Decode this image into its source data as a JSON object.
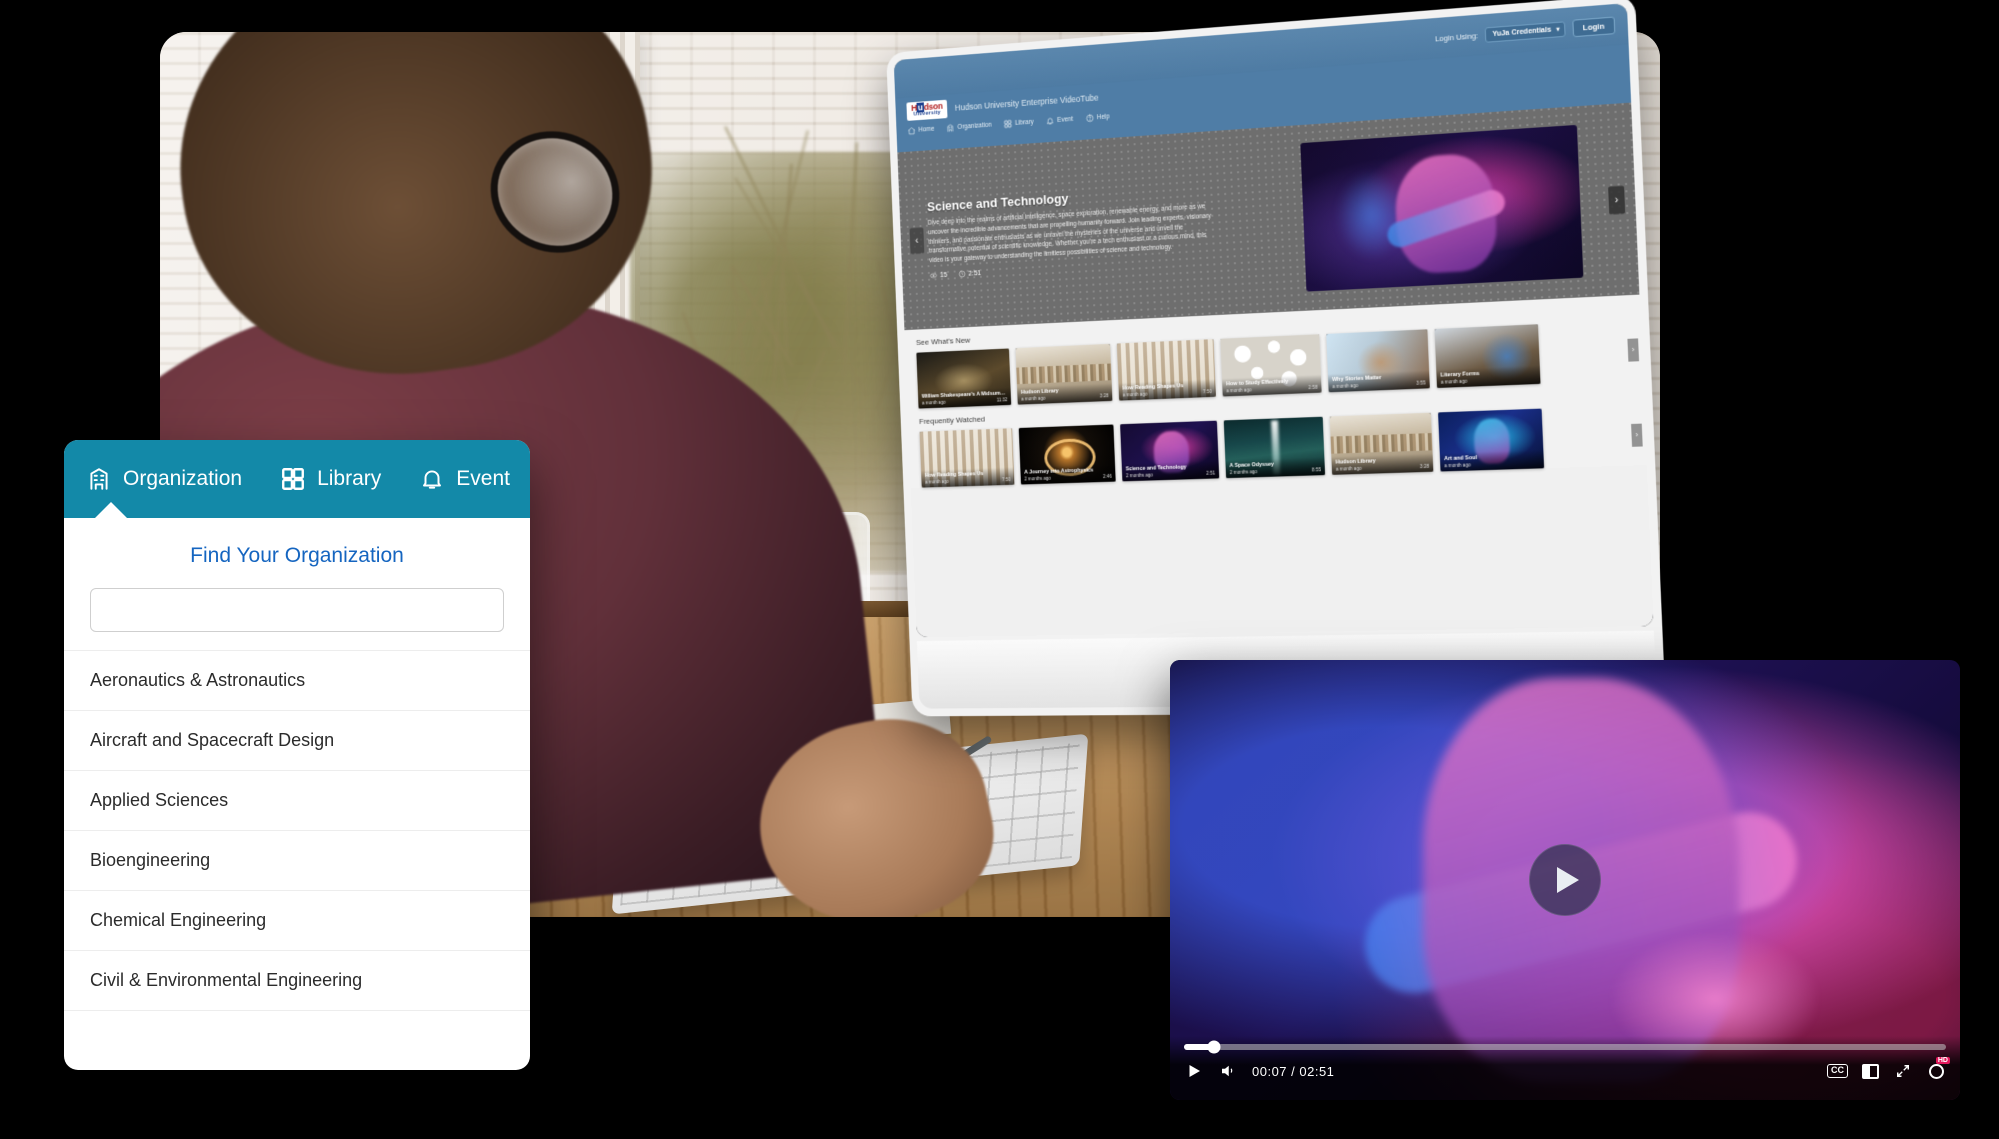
{
  "org_card": {
    "tabs": [
      {
        "label": "Organization",
        "icon": "building-icon"
      },
      {
        "label": "Library",
        "icon": "grid-icon"
      },
      {
        "label": "Event",
        "icon": "bell-icon"
      }
    ],
    "title": "Find Your Organization",
    "search_placeholder": "",
    "search_value": "",
    "items": [
      "Aeronautics & Astronautics",
      "Aircraft and Spacecraft Design",
      "Applied Sciences",
      "Bioengineering",
      "Chemical Engineering",
      "Civil & Environmental Engineering"
    ],
    "accent_color": "#1389A8",
    "title_color": "#1565C0"
  },
  "videotube": {
    "topbar": {
      "login_using_label": "Login Using:",
      "credential_option": "YuJa Credentials",
      "caret": "▾",
      "login_button": "Login"
    },
    "brand": {
      "logo_line1_pre": "H",
      "logo_line1_hl": "u",
      "logo_line1_post": "dson",
      "logo_line2": "University",
      "site_title": "Hudson University Enterprise VideoTube"
    },
    "nav": [
      {
        "label": "Home",
        "icon": "home-icon"
      },
      {
        "label": "Organization",
        "icon": "building-icon"
      },
      {
        "label": "Library",
        "icon": "grid-icon"
      },
      {
        "label": "Event",
        "icon": "bell-icon"
      },
      {
        "label": "Help",
        "icon": "help-icon"
      }
    ],
    "hero": {
      "title": "Science and Technology",
      "description": "Dive deep into the realms of artificial intelligence, space exploration, renewable energy, and more as we uncover the incredible advancements that are propelling humanity forward. Join leading experts, visionary thinkers, and passionate enthusiasts as we unravel the mysteries of the universe and unveil the transformative potential of scientific knowledge. Whether you're a tech enthusiast or a curious mind, this video is your gateway to understanding the limitless possibilities of science and technology.",
      "views": "15",
      "duration": "2:51",
      "prev_arrow": "‹",
      "next_arrow": "›"
    },
    "sections": [
      {
        "title": "See What's New",
        "next_arrow": "›",
        "videos": [
          {
            "title": "William Shakespeare's A Midsumm...",
            "age": "a month ago",
            "duration": "11:32",
            "art": "t-shake"
          },
          {
            "title": "Hudson Library",
            "age": "a month ago",
            "duration": "3:28",
            "art": "t-lib"
          },
          {
            "title": "How Reading Shapes Us",
            "age": "a month ago",
            "duration": "7:50",
            "art": "t-read"
          },
          {
            "title": "How to Study Effectively",
            "age": "a month ago",
            "duration": "2:58",
            "art": "t-study"
          },
          {
            "title": "Why Stories Matter",
            "age": "a month ago",
            "duration": "3:55",
            "art": "t-story"
          },
          {
            "title": "Literary Forms",
            "age": "a month ago",
            "duration": "",
            "art": "t-form"
          }
        ]
      },
      {
        "title": "Frequently Watched",
        "next_arrow": "›",
        "videos": [
          {
            "title": "How Reading Shapes Us",
            "age": "a month ago",
            "duration": "7:50",
            "art": "t-read"
          },
          {
            "title": "A Journey into Astrophysics",
            "age": "2 months ago",
            "duration": "2:46",
            "art": "t-astro"
          },
          {
            "title": "Science and Technology",
            "age": "2 months ago",
            "duration": "2:51",
            "art": "t-sci"
          },
          {
            "title": "A Space Odyssey",
            "age": "2 months ago",
            "duration": "8:55",
            "art": "t-space"
          },
          {
            "title": "Hudson Library",
            "age": "a month ago",
            "duration": "3:28",
            "art": "t-lib"
          },
          {
            "title": "Art and Soul",
            "age": "a month ago",
            "duration": "",
            "art": "t-art"
          }
        ]
      }
    ]
  },
  "player": {
    "current_time": "00:07",
    "total_time": "02:51",
    "time_display": "00:07 / 02:51",
    "progress_percent": 4,
    "cc_label": "CC",
    "hd_badge": "HD",
    "controls": [
      "play-icon",
      "volume-icon",
      "cc-icon",
      "theater-icon",
      "fullscreen-icon",
      "settings-gear-icon"
    ]
  }
}
